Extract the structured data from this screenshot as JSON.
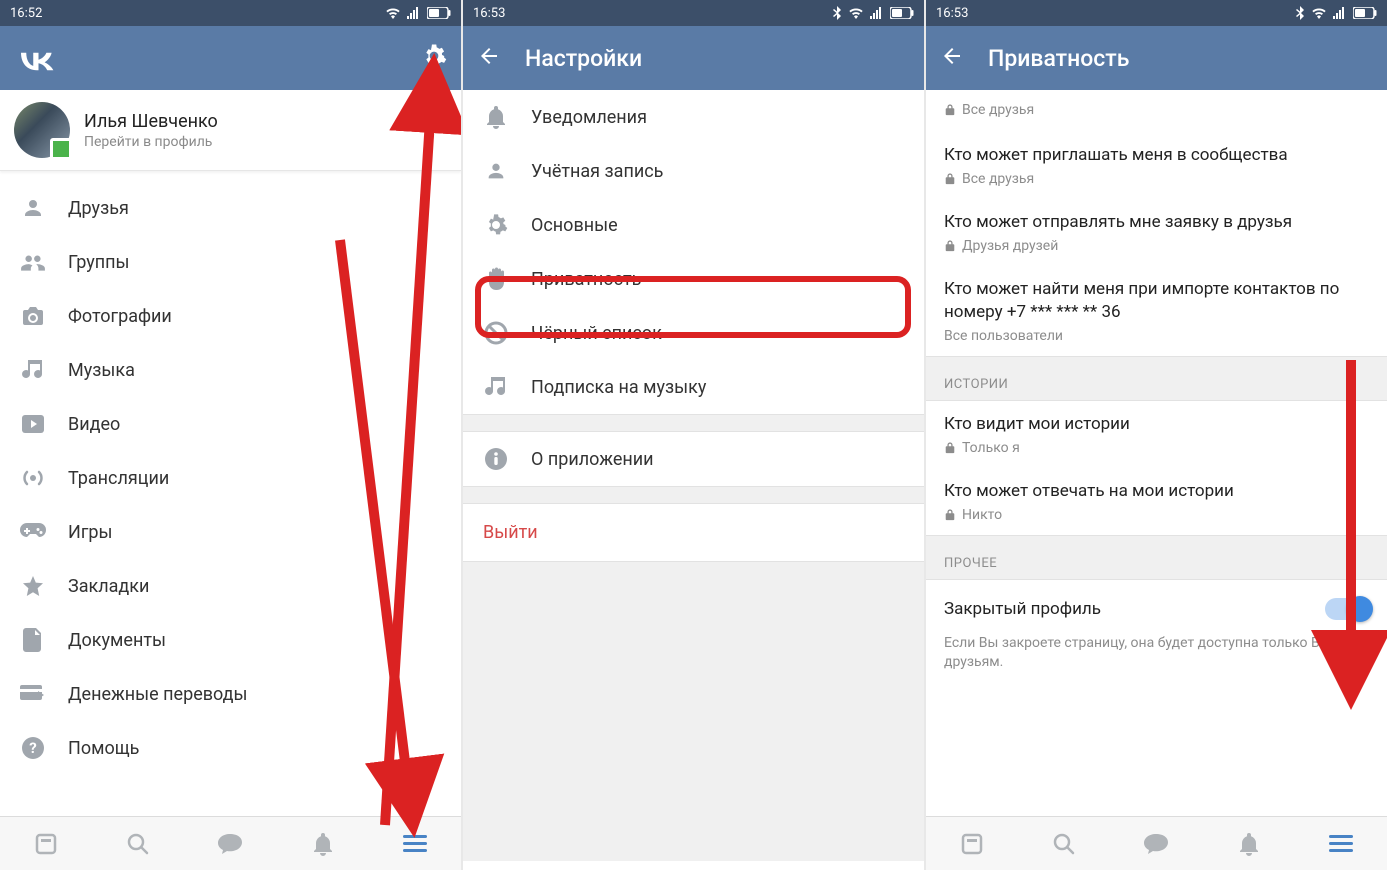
{
  "screen1": {
    "status_time": "16:52",
    "profile": {
      "name": "Илья Шевченко",
      "subtitle": "Перейти в профиль"
    },
    "menu": {
      "friends": "Друзья",
      "groups": "Группы",
      "photos": "Фотографии",
      "music": "Музыка",
      "videos": "Видео",
      "live": "Трансляции",
      "games": "Игры",
      "bookmarks": "Закладки",
      "docs": "Документы",
      "money": "Денежные переводы",
      "help": "Помощь"
    }
  },
  "screen2": {
    "status_time": "16:53",
    "title": "Настройки",
    "items": {
      "notifications": "Уведомления",
      "account": "Учётная запись",
      "general": "Основные",
      "privacy": "Приватность",
      "blacklist": "Чёрный список",
      "music_sub": "Подписка на музыку",
      "about": "О приложении"
    },
    "logout": "Выйти"
  },
  "screen3": {
    "status_time": "16:53",
    "title": "Приватность",
    "top_value": "Все друзья",
    "rows": {
      "invite_groups": {
        "title": "Кто может приглашать меня в сообщества",
        "value": "Все друзья"
      },
      "friend_req": {
        "title": "Кто может отправлять мне заявку в друзья",
        "value": "Друзья друзей"
      },
      "import": {
        "title": "Кто может найти меня при импорте контактов по номеру +7 *** *** ** 36",
        "value": "Все пользователи"
      }
    },
    "sect_stories": "ИСТОРИИ",
    "stories": {
      "who_sees": {
        "title": "Кто видит мои истории",
        "value": "Только я"
      },
      "who_replies": {
        "title": "Кто может отвечать на мои истории",
        "value": "Никто"
      }
    },
    "sect_other": "ПРОЧЕЕ",
    "closed": {
      "label": "Закрытый профиль",
      "note": "Если Вы закроете страницу, она будет доступна только Вашим друзьям."
    }
  }
}
